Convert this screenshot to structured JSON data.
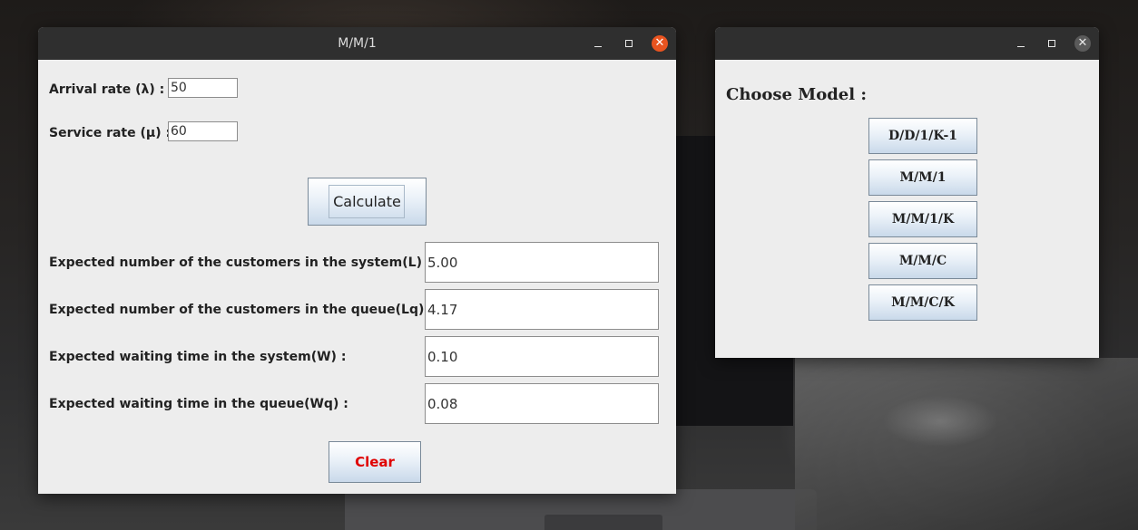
{
  "mm1_window": {
    "title": "M/M/1",
    "arrival_label": "Arrival rate (λ)  :",
    "arrival_value": "50",
    "service_label": "Service rate (μ) :",
    "service_value": "60",
    "calculate_label": "Calculate",
    "results": [
      {
        "label": "Expected number of the customers in the system(L) :",
        "value": "5.00"
      },
      {
        "label": "Expected number of the customers in the queue(Lq) :",
        "value": "4.17"
      },
      {
        "label": "Expected waiting time in the system(W) :",
        "value": "0.10"
      },
      {
        "label": "Expected waiting time in the queue(Wq) :",
        "value": "0.08"
      }
    ],
    "clear_label": "Clear"
  },
  "model_window": {
    "title": "",
    "heading": "Choose Model :",
    "models": [
      "D/D/1/K-1",
      "M/M/1",
      "M/M/1/K",
      "M/M/C",
      "M/M/C/K"
    ]
  },
  "window_controls": {
    "minimize_icon": "minimize-icon",
    "maximize_icon": "maximize-icon",
    "close_icon": "close-icon",
    "close_glyph": "✕"
  },
  "colors": {
    "active_close": "#e95420",
    "titlebar": "#2f2f2f",
    "window_bg": "#ededed",
    "clear_text": "#e00000"
  }
}
